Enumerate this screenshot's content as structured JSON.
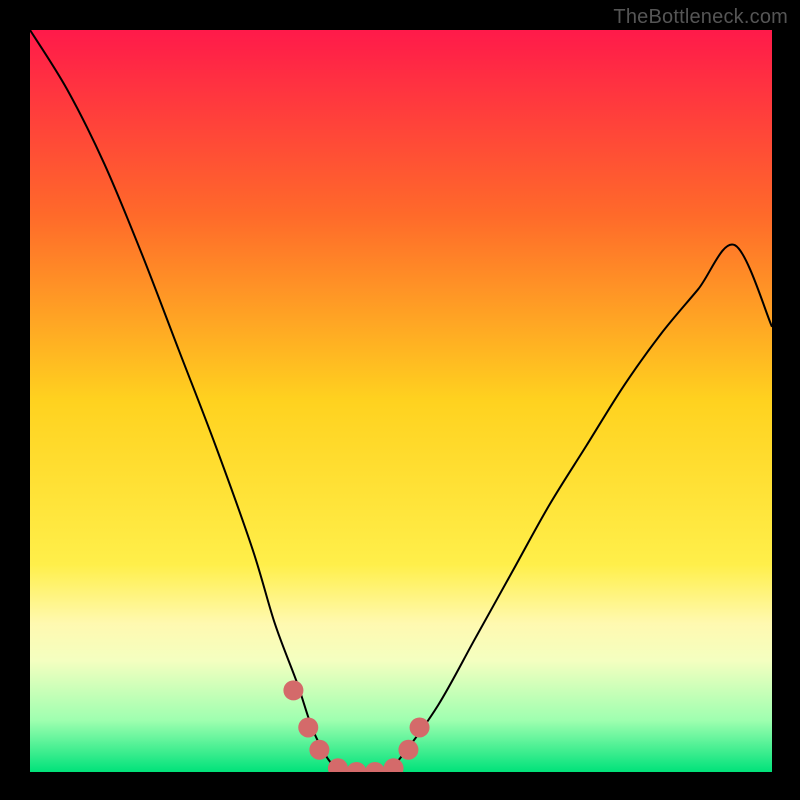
{
  "watermark": "TheBottleneck.com",
  "chart_data": {
    "type": "line",
    "title": "",
    "xlabel": "",
    "ylabel": "",
    "xlim": [
      0,
      100
    ],
    "ylim": [
      0,
      100
    ],
    "gradient_stops": [
      {
        "offset": 0,
        "color": "#ff1a4a"
      },
      {
        "offset": 25,
        "color": "#ff6a2a"
      },
      {
        "offset": 50,
        "color": "#ffd21f"
      },
      {
        "offset": 72,
        "color": "#ffef4a"
      },
      {
        "offset": 80,
        "color": "#fff9b0"
      },
      {
        "offset": 85,
        "color": "#f4ffc0"
      },
      {
        "offset": 93,
        "color": "#9fffb0"
      },
      {
        "offset": 100,
        "color": "#00e27a"
      }
    ],
    "series": [
      {
        "name": "bottleneck-curve",
        "color": "#000000",
        "stroke_width": 2,
        "x": [
          0,
          5,
          10,
          15,
          20,
          25,
          30,
          33,
          36,
          38,
          40,
          42,
          44,
          46,
          48,
          50,
          55,
          60,
          65,
          70,
          75,
          80,
          85,
          90,
          95,
          100
        ],
        "y": [
          100,
          92,
          82,
          70,
          57,
          44,
          30,
          20,
          12,
          6,
          2,
          0,
          0,
          0,
          0,
          2,
          9,
          18,
          27,
          36,
          44,
          52,
          59,
          65,
          71,
          60
        ]
      }
    ],
    "markers": {
      "name": "valley-markers",
      "color": "#d46a6a",
      "radius": 10,
      "points": [
        {
          "x": 35.5,
          "y": 11
        },
        {
          "x": 37.5,
          "y": 6
        },
        {
          "x": 39,
          "y": 3
        },
        {
          "x": 41.5,
          "y": 0.5
        },
        {
          "x": 44,
          "y": 0
        },
        {
          "x": 46.5,
          "y": 0
        },
        {
          "x": 49,
          "y": 0.5
        },
        {
          "x": 51,
          "y": 3
        },
        {
          "x": 52.5,
          "y": 6
        }
      ]
    }
  }
}
